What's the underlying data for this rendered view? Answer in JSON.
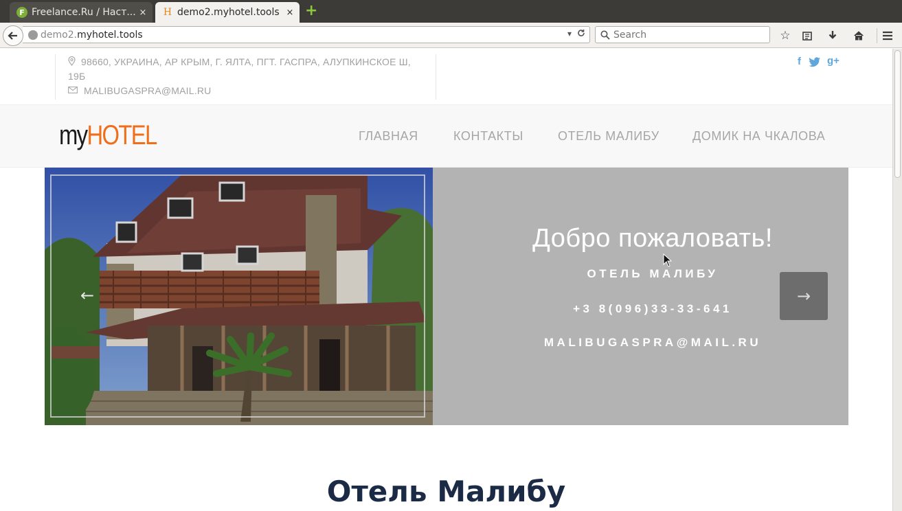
{
  "browser": {
    "tabs": [
      {
        "favicon": "F",
        "title": "Freelance.Ru / Наст...",
        "close": "×"
      },
      {
        "favicon": "H",
        "title": "demo2.myhotel.tools",
        "close": "×"
      }
    ],
    "new_tab": "+",
    "url": {
      "prefix": "demo2.",
      "host": "myhotel.tools"
    },
    "search_placeholder": "Search"
  },
  "page": {
    "contact": {
      "address_line1": "98660, УКРАИНА, АР КРЫМ, Г. ЯЛТА, ПГТ. ГАСПРА, АЛУПКИНСКОЕ Ш,",
      "address_line2": "19Б",
      "email": "MALIBUGASPRA@MAIL.RU"
    },
    "social": {
      "facebook": "f",
      "google_plus": "g+"
    },
    "logo": {
      "my": "my",
      "hotel": "HOTEL"
    },
    "menu": [
      "ГЛАВНАЯ",
      "КОНТАКТЫ",
      "ОТЕЛЬ МАЛИБУ",
      "ДОМИК НА ЧКАЛОВА"
    ],
    "slider": {
      "welcome": "Добро пожаловать!",
      "hotel_name": "ОТЕЛЬ МАЛИБУ",
      "phone": "+3 8(096)33-33-641",
      "email": "MALIBUGASPRA@MAIL.RU",
      "prev_arrow": "←",
      "next_arrow": "→"
    },
    "section_title": "Отель Малибу"
  },
  "colors": {
    "accent_orange": "#ef6e1a",
    "title_navy": "#1b2a45",
    "social_blue": "#5fa7db",
    "slider_gray": "#b3b3b3"
  }
}
